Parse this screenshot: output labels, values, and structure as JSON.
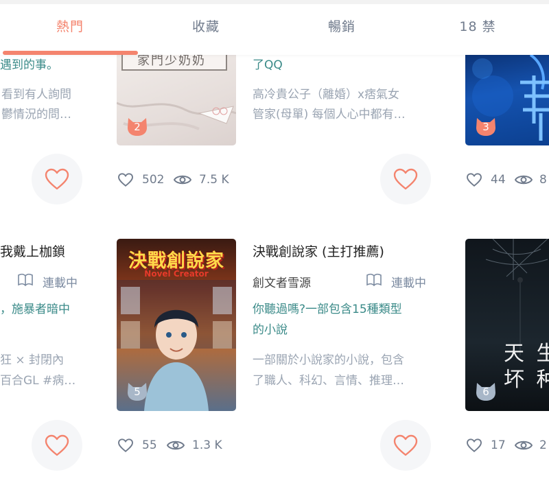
{
  "tabs": [
    {
      "label": "熱門",
      "active": true
    },
    {
      "label": "收藏",
      "active": false
    },
    {
      "label": "暢銷",
      "active": false
    },
    {
      "label": "18 禁",
      "active": false
    }
  ],
  "colors": {
    "accent": "#f4846e",
    "teal": "#3a8a88",
    "muted": "#9aa4b2",
    "rank_gray": "#a8b7c8"
  },
  "row1": {
    "left": {
      "tagline_tail": "遇到的事。",
      "desc_line1": "看到有人詢問",
      "desc_line2": "鬱情況的問…"
    },
    "book2": {
      "rank": "2",
      "cover_text": "家門少奶奶",
      "likes": "502",
      "views": "7.5 K"
    },
    "middle": {
      "tagline_tail": "了QQ",
      "desc_line1": "高冷貴公子（離婚）x痞氣女",
      "desc_line2": "管家(母單) 每個人心中都有…"
    },
    "book3": {
      "rank": "3",
      "likes": "44",
      "views": "8"
    }
  },
  "row2": {
    "left": {
      "title_tail": "我戴上枷鎖",
      "serial": "連載中",
      "tagline": "，施暴者暗中",
      "desc_line1": "狂 × 封閉內",
      "desc_line2": "百合GL #病…"
    },
    "book5": {
      "rank": "5",
      "cover_title": "決戰創說家",
      "cover_subtitle": "Novel Creator",
      "likes": "55",
      "views": "1.3 K"
    },
    "middle": {
      "title": "決戰創說家 (主打推薦)",
      "author": "創文者雪源",
      "serial": "連載中",
      "tagline_line1": "你聽過嗎?一部包含15種類型",
      "tagline_line2": "的小說",
      "desc_line1": "一部關於小說家的小說，包含",
      "desc_line2": "了職人、科幻、言情、推理…"
    },
    "book6": {
      "rank": "6",
      "cover_line1": "天 生",
      "cover_line2": "坏 种",
      "likes": "17",
      "views": "2"
    }
  }
}
